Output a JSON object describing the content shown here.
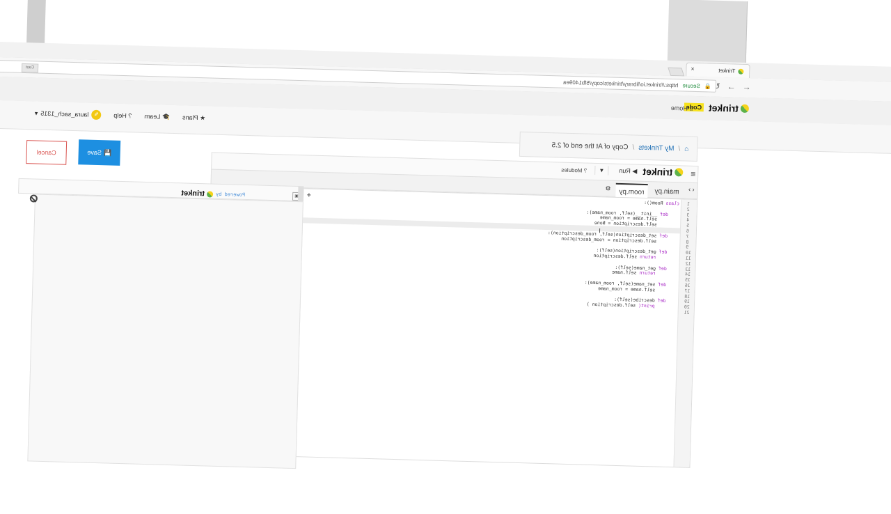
{
  "browser": {
    "tab_title": "Trinket",
    "tab_close": "×",
    "omnibox_secure": "Secure",
    "omnibox_url": "https://trinket.io/library/trinkets/copy/5fb1409ea",
    "ext_label": "Cast"
  },
  "site_header": {
    "logo_text": "trinket",
    "code_badge": "Code",
    "home_link": "Home"
  },
  "navbar": {
    "plans": "Plans",
    "learn": "Learn",
    "help": "Help",
    "username": "laura_sach_1315"
  },
  "breadcrumb": {
    "my_trinkets": "My Trinkets",
    "separator": "/",
    "current": "Copy of At the end of 2.5"
  },
  "actions": {
    "save": "Save",
    "cancel": "Cancel"
  },
  "editor": {
    "logo_text": "trinket",
    "run": "Run",
    "modules": "Modules",
    "tabs": [
      "main.py",
      "room.py"
    ],
    "active_tab": "room.py",
    "line_numbers": [
      "1",
      "2",
      "3",
      "4",
      "5",
      "6",
      "7",
      "8",
      "9",
      "10",
      "11",
      "12",
      "13",
      "14",
      "15",
      "16",
      "17",
      "18",
      "19",
      "20",
      "21"
    ],
    "code": [
      {
        "kw": "class",
        "rest": " Room():"
      },
      {
        "kw": "",
        "rest": ""
      },
      {
        "kw": "    def",
        "rest": " __init__(self, room_name):"
      },
      {
        "kw": "",
        "rest": "        self.name = room_name"
      },
      {
        "kw": "",
        "rest": "        self.description = None"
      },
      {
        "kw": "",
        "rest": ""
      },
      {
        "kw": "    def",
        "rest": " set_description(self, room_description):"
      },
      {
        "kw": "",
        "rest": "        self.description = room_description"
      },
      {
        "kw": "",
        "rest": ""
      },
      {
        "kw": "    def",
        "rest": " get_description(self):"
      },
      {
        "kw": "        return",
        "rest": " self.description"
      },
      {
        "kw": "",
        "rest": ""
      },
      {
        "kw": "    def",
        "rest": " get_name(self):"
      },
      {
        "kw": "        return",
        "rest": " self.name"
      },
      {
        "kw": "",
        "rest": ""
      },
      {
        "kw": "    def",
        "rest": " set_name(self, room_name):"
      },
      {
        "kw": "",
        "rest": "        self.name = room_name"
      },
      {
        "kw": "",
        "rest": ""
      },
      {
        "kw": "    def",
        "rest": " describe(self):"
      },
      {
        "kw": "        print(",
        "rest": " self.description )"
      },
      {
        "kw": "",
        "rest": ""
      }
    ]
  },
  "output": {
    "powered_by": "Powered by",
    "logo_text": "trinket"
  }
}
